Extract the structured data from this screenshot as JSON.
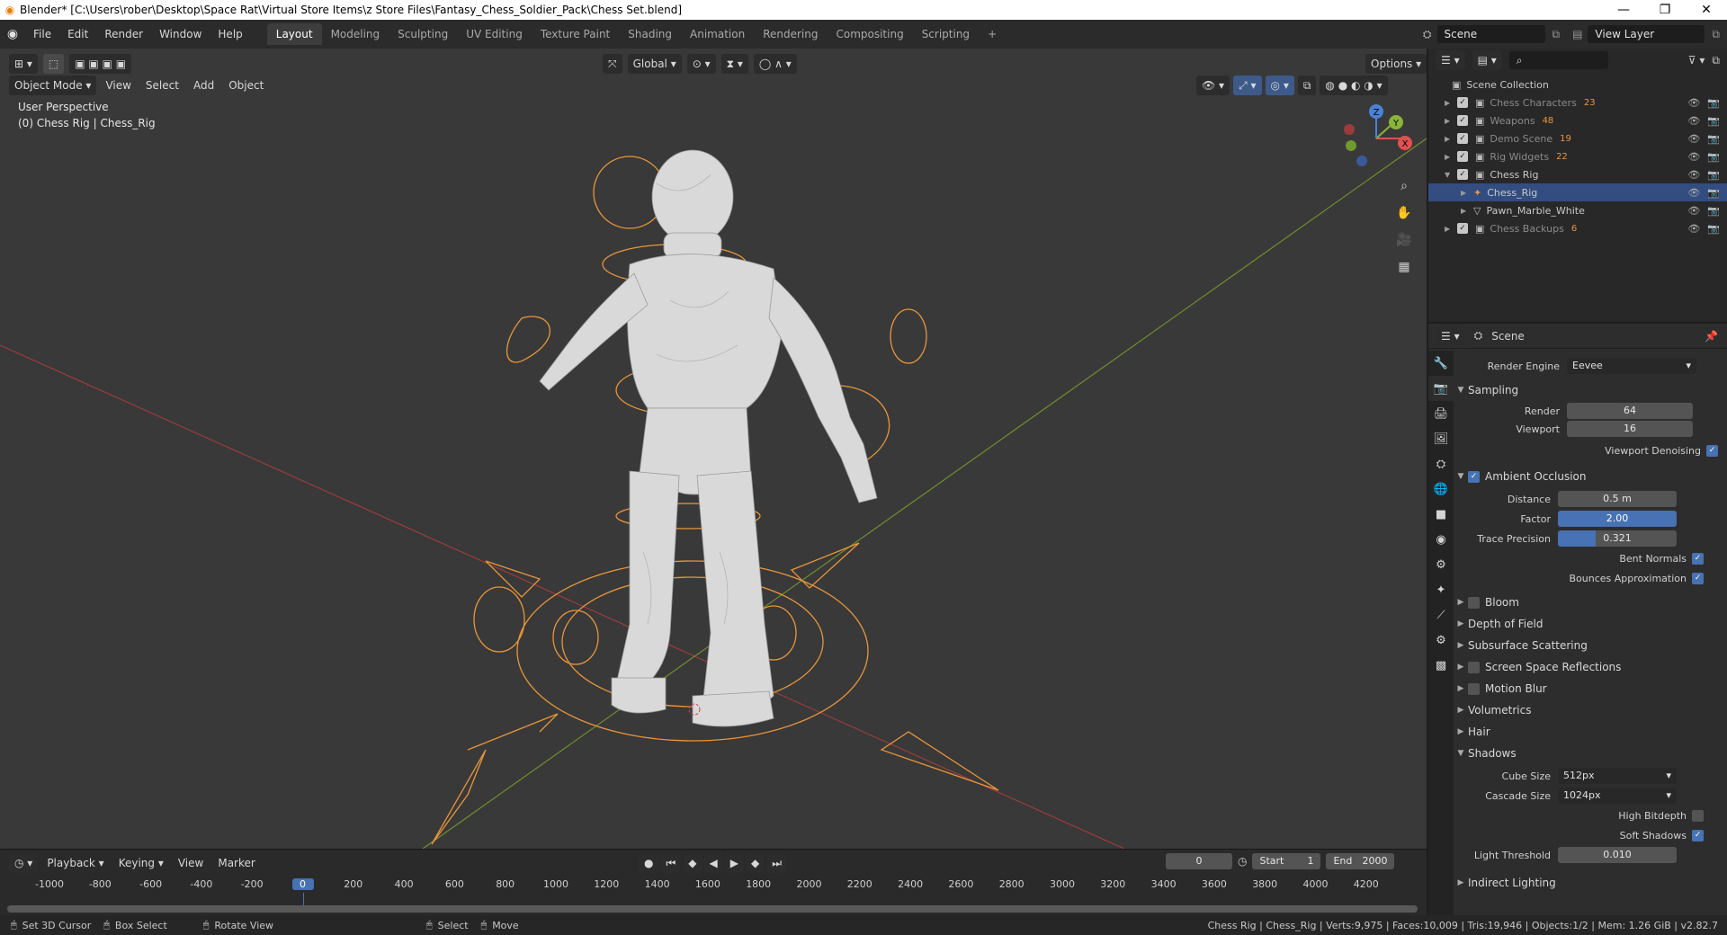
{
  "window": {
    "title": "Blender* [C:\\Users\\rober\\Desktop\\Space Rat\\Virtual Store Items\\z Store Files\\Fantasy_Chess_Soldier_Pack\\Chess Set.blend]",
    "min": "—",
    "max": "❐",
    "close": "✕"
  },
  "menu": {
    "items": [
      "File",
      "Edit",
      "Render",
      "Window",
      "Help"
    ],
    "workspaces": [
      "Layout",
      "Modeling",
      "Sculpting",
      "UV Editing",
      "Texture Paint",
      "Shading",
      "Animation",
      "Rendering",
      "Compositing",
      "Scripting"
    ],
    "add_workspace": "+",
    "scene": "Scene",
    "view_layer": "View Layer"
  },
  "viewport": {
    "mode": "Object Mode",
    "menus": [
      "View",
      "Select",
      "Add",
      "Object"
    ],
    "transform_orientation": "Global",
    "options": "Options",
    "perspective": "User Perspective",
    "active": "(0) Chess Rig | Chess_Rig",
    "gizmo": {
      "x": "X",
      "y": "Y",
      "z": "Z"
    }
  },
  "timeline": {
    "menus": [
      "Playback",
      "Keying",
      "View",
      "Marker"
    ],
    "current_frame": "0",
    "start_label": "Start",
    "start": "1",
    "end_label": "End",
    "end": "2000",
    "ticks": [
      "-1000",
      "-800",
      "-600",
      "-400",
      "-200",
      "0",
      "200",
      "400",
      "600",
      "800",
      "1000",
      "1200",
      "1400",
      "1600",
      "1800",
      "2000",
      "2200",
      "2400",
      "2600",
      "2800",
      "3000",
      "3200",
      "3400",
      "3600",
      "3800",
      "4000",
      "4200"
    ],
    "playhead": "0"
  },
  "status": {
    "left": [
      "Set 3D Cursor",
      "Box Select",
      "Rotate View",
      "Select",
      "Move"
    ],
    "right": "Chess Rig | Chess_Rig | Verts:9,975 | Faces:10,009 | Tris:19,946 | Objects:1/2 | Mem: 1.26 GiB | v2.82.7"
  },
  "outliner": {
    "root": "Scene Collection",
    "rows": [
      {
        "label": "Chess Characters",
        "count": "23",
        "dim": true
      },
      {
        "label": "Weapons",
        "count": "48",
        "dim": true
      },
      {
        "label": "Demo Scene",
        "count": "19",
        "dim": true
      },
      {
        "label": "Rig Widgets",
        "count": "22",
        "dim": true
      },
      {
        "label": "Chess Rig",
        "count": "",
        "dim": false
      },
      {
        "label": "Chess_Rig",
        "count": "",
        "dim": false
      },
      {
        "label": "Pawn_Marble_White",
        "count": "",
        "dim": false
      },
      {
        "label": "Chess Backups",
        "count": "6",
        "dim": true
      }
    ]
  },
  "properties": {
    "context": "Scene",
    "render_engine_label": "Render Engine",
    "render_engine": "Eevee",
    "sampling": "Sampling",
    "render_label": "Render",
    "render": "64",
    "viewport_label": "Viewport",
    "viewport": "16",
    "viewport_denoising": "Viewport Denoising",
    "ao": "Ambient Occlusion",
    "distance_label": "Distance",
    "distance": "0.5 m",
    "factor_label": "Factor",
    "factor": "2.00",
    "trace_label": "Trace Precision",
    "trace": "0.321",
    "bent_normals": "Bent Normals",
    "bounces": "Bounces Approximation",
    "bloom": "Bloom",
    "dof": "Depth of Field",
    "sss": "Subsurface Scattering",
    "ssr": "Screen Space Reflections",
    "motion_blur": "Motion Blur",
    "volumetrics": "Volumetrics",
    "hair": "Hair",
    "shadows": "Shadows",
    "cube_size_label": "Cube Size",
    "cube_size": "512px",
    "cascade_size_label": "Cascade Size",
    "cascade_size": "1024px",
    "high_bitdepth": "High Bitdepth",
    "soft_shadows": "Soft Shadows",
    "light_threshold_label": "Light Threshold",
    "light_threshold": "0.010",
    "indirect": "Indirect Lighting"
  },
  "colors": {
    "accent": "#4772b3",
    "selection": "#e87d0d",
    "viewport_bg": "#393939",
    "x_axis": "#9b3c3c",
    "y_axis": "#6e8f2e"
  }
}
